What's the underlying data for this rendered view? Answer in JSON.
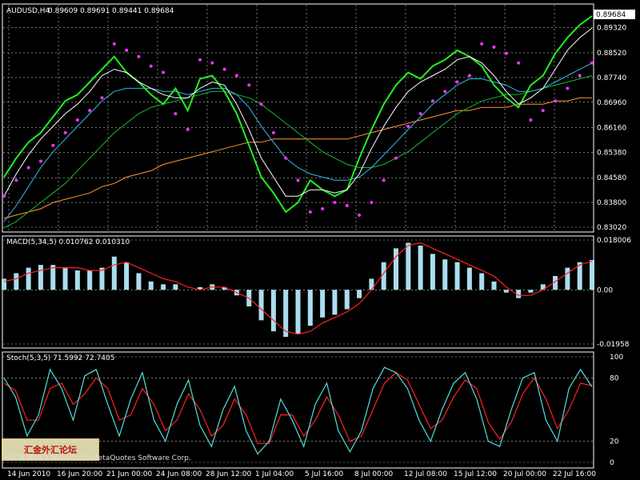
{
  "chart_data": {
    "type": "line",
    "instrument_label": "AUDUSD,H4",
    "ohlc_label": "0.89609 0.89691 0.89441 0.89684",
    "last_price_label": "0.89684",
    "price_axis_labels": [
      "0.89320",
      "0.88520",
      "0.87740",
      "0.86960",
      "0.86160",
      "0.85380",
      "0.84580",
      "0.83800",
      "0.83020"
    ],
    "price_ylim": [
      0.8302,
      0.8968
    ],
    "x_tick_labels": [
      "14 Jun 2010",
      "16 Jun 20:00",
      "21 Jun 00:00",
      "24 Jun 08:00",
      "28 Jun 12:00",
      "1 Jul 04:00",
      "5 Jul 16:00",
      "8 Jul 00:00",
      "12 Jul 08:00",
      "15 Jul 12:00",
      "20 Jul 00:00",
      "22 Jul 16:00"
    ],
    "price_series": {
      "name": "AUDUSD close",
      "values": [
        0.846,
        0.852,
        0.857,
        0.86,
        0.865,
        0.87,
        0.872,
        0.876,
        0.88,
        0.884,
        0.879,
        0.876,
        0.872,
        0.869,
        0.874,
        0.867,
        0.877,
        0.878,
        0.873,
        0.866,
        0.856,
        0.846,
        0.841,
        0.835,
        0.838,
        0.845,
        0.842,
        0.84,
        0.842,
        0.852,
        0.861,
        0.869,
        0.875,
        0.879,
        0.877,
        0.881,
        0.883,
        0.886,
        0.884,
        0.881,
        0.875,
        0.871,
        0.868,
        0.875,
        0.878,
        0.885,
        0.89,
        0.894,
        0.8968
      ]
    },
    "ma_fast": [
      0.84,
      0.847,
      0.853,
      0.858,
      0.862,
      0.866,
      0.869,
      0.873,
      0.878,
      0.88,
      0.879,
      0.876,
      0.874,
      0.872,
      0.871,
      0.871,
      0.874,
      0.876,
      0.875,
      0.869,
      0.861,
      0.852,
      0.846,
      0.84,
      0.84,
      0.842,
      0.842,
      0.841,
      0.842,
      0.847,
      0.855,
      0.862,
      0.868,
      0.873,
      0.876,
      0.878,
      0.88,
      0.883,
      0.884,
      0.882,
      0.878,
      0.873,
      0.869,
      0.871,
      0.874,
      0.88,
      0.886,
      0.89,
      0.893
    ],
    "ma_mid": [
      0.832,
      0.837,
      0.843,
      0.849,
      0.854,
      0.858,
      0.862,
      0.866,
      0.87,
      0.873,
      0.874,
      0.874,
      0.874,
      0.873,
      0.873,
      0.872,
      0.873,
      0.874,
      0.874,
      0.872,
      0.868,
      0.862,
      0.857,
      0.852,
      0.849,
      0.847,
      0.846,
      0.845,
      0.845,
      0.846,
      0.849,
      0.853,
      0.857,
      0.861,
      0.865,
      0.869,
      0.872,
      0.875,
      0.877,
      0.877,
      0.876,
      0.875,
      0.873,
      0.873,
      0.874,
      0.876,
      0.878,
      0.88,
      0.882
    ],
    "ma_slow": [
      0.83,
      0.832,
      0.835,
      0.838,
      0.841,
      0.844,
      0.848,
      0.852,
      0.856,
      0.86,
      0.863,
      0.866,
      0.868,
      0.869,
      0.87,
      0.871,
      0.872,
      0.873,
      0.873,
      0.872,
      0.871,
      0.869,
      0.866,
      0.863,
      0.86,
      0.857,
      0.854,
      0.852,
      0.85,
      0.849,
      0.849,
      0.85,
      0.852,
      0.854,
      0.857,
      0.86,
      0.863,
      0.866,
      0.868,
      0.87,
      0.871,
      0.872,
      0.872,
      0.873,
      0.874,
      0.875,
      0.876,
      0.877,
      0.878
    ],
    "ma_long": [
      0.833,
      0.834,
      0.835,
      0.836,
      0.838,
      0.839,
      0.84,
      0.841,
      0.843,
      0.844,
      0.846,
      0.847,
      0.848,
      0.85,
      0.851,
      0.852,
      0.853,
      0.854,
      0.855,
      0.856,
      0.857,
      0.857,
      0.858,
      0.858,
      0.858,
      0.858,
      0.858,
      0.858,
      0.858,
      0.859,
      0.86,
      0.861,
      0.862,
      0.863,
      0.864,
      0.865,
      0.866,
      0.867,
      0.867,
      0.868,
      0.868,
      0.868,
      0.869,
      0.869,
      0.869,
      0.87,
      0.87,
      0.871,
      0.871
    ],
    "psar": [
      0.84,
      0.845,
      0.849,
      0.851,
      0.856,
      0.86,
      0.864,
      0.867,
      0.871,
      0.888,
      0.886,
      0.884,
      0.881,
      0.879,
      0.866,
      0.861,
      0.883,
      0.882,
      0.88,
      0.878,
      0.875,
      0.869,
      0.86,
      0.852,
      0.845,
      0.835,
      0.836,
      0.838,
      0.837,
      0.834,
      0.838,
      0.845,
      0.852,
      0.862,
      0.866,
      0.87,
      0.873,
      0.876,
      0.878,
      0.888,
      0.887,
      0.885,
      0.882,
      0.864,
      0.867,
      0.87,
      0.874,
      0.878,
      0.882
    ],
    "macd_label": "MACD(5,34,5) 0.010762 0.010310",
    "macd_axis_labels": [
      "0.018006",
      "0.00",
      "-0.01958"
    ],
    "macd_ylim": [
      -0.01958,
      0.018006
    ],
    "macd_hist": [
      0.004,
      0.006,
      0.008,
      0.009,
      0.009,
      0.008,
      0.007,
      0.007,
      0.008,
      0.012,
      0.01,
      0.006,
      0.003,
      0.002,
      0.002,
      0.0,
      0.001,
      0.002,
      0.001,
      -0.002,
      -0.006,
      -0.011,
      -0.015,
      -0.017,
      -0.016,
      -0.013,
      -0.01,
      -0.009,
      -0.007,
      -0.003,
      0.004,
      0.01,
      0.015,
      0.017,
      0.016,
      0.013,
      0.011,
      0.01,
      0.008,
      0.006,
      0.003,
      -0.001,
      -0.003,
      -0.001,
      0.002,
      0.005,
      0.008,
      0.01,
      0.010762
    ],
    "macd_signal": [
      0.003,
      0.004,
      0.006,
      0.007,
      0.008,
      0.008,
      0.008,
      0.007,
      0.007,
      0.009,
      0.01,
      0.008,
      0.006,
      0.004,
      0.003,
      0.001,
      0.0,
      0.001,
      0.001,
      -0.001,
      -0.003,
      -0.007,
      -0.011,
      -0.015,
      -0.016,
      -0.015,
      -0.012,
      -0.01,
      -0.008,
      -0.005,
      0.0,
      0.006,
      0.012,
      0.016,
      0.017,
      0.015,
      0.013,
      0.011,
      0.009,
      0.007,
      0.005,
      0.001,
      -0.002,
      -0.002,
      0.0,
      0.003,
      0.006,
      0.009,
      0.01031
    ],
    "stoch_label": "Stoch(5,3,5) 71.5992 72.7405",
    "stoch_axis_labels": [
      "100",
      "80",
      "20",
      "0"
    ],
    "stoch_ylim": [
      0,
      100
    ],
    "stoch_k": [
      80,
      62,
      25,
      45,
      88,
      70,
      40,
      82,
      88,
      55,
      25,
      60,
      85,
      40,
      20,
      55,
      78,
      35,
      15,
      50,
      72,
      30,
      8,
      20,
      60,
      40,
      15,
      55,
      75,
      30,
      10,
      30,
      70,
      90,
      85,
      70,
      40,
      20,
      50,
      75,
      85,
      60,
      20,
      15,
      50,
      80,
      85,
      40,
      20,
      70,
      88,
      71.5992
    ],
    "stoch_d": [
      75,
      68,
      40,
      40,
      70,
      75,
      55,
      65,
      80,
      70,
      40,
      45,
      70,
      55,
      30,
      40,
      65,
      50,
      25,
      35,
      60,
      45,
      18,
      18,
      45,
      45,
      25,
      40,
      62,
      45,
      20,
      25,
      50,
      75,
      85,
      78,
      55,
      32,
      40,
      62,
      78,
      70,
      38,
      22,
      38,
      65,
      80,
      60,
      32,
      50,
      75,
      72.7405
    ],
    "stamp_text": "汇金外汇论坛",
    "footer_text": "FXCM MT4 ? 2001-2010 MetaQuotes Software Corp.",
    "colors": {
      "background": "#000000",
      "grid": "#c0c0c0",
      "axis": "#ffffff",
      "price": "#22ee22",
      "ma_fast": "#ffffff",
      "ma_mid": "#33bbee",
      "ma_slow": "#11bb33",
      "ma_long": "#ff9933",
      "psar": "#ff33ff",
      "macd_hist": "#aaddee",
      "macd_signal": "#ff2222",
      "stoch_k": "#55dddd",
      "stoch_d": "#ff2222"
    }
  }
}
